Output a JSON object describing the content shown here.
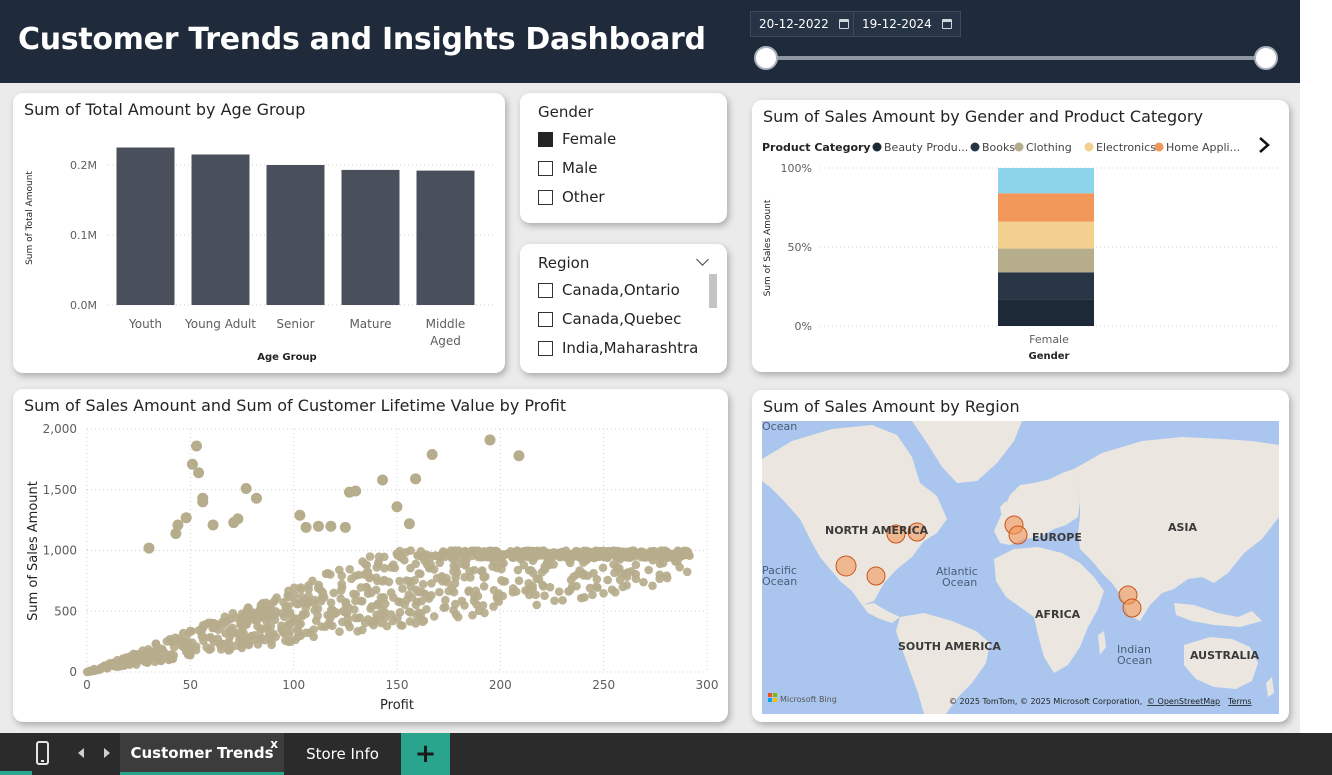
{
  "header": {
    "title": "Customer Trends and Insights Dashboard",
    "date_start": "20-12-2022",
    "date_end": "19-12-2024",
    "date_range_fraction": [
      0,
      1
    ]
  },
  "age_chart": {
    "title": "Sum of Total Amount by Age Group",
    "chart_data": {
      "type": "bar",
      "title": "Sum of Total Amount by Age Group",
      "categories": [
        "Youth",
        "Young Adult",
        "Senior",
        "Mature",
        "Middle Aged"
      ],
      "values": [
        225000,
        215000,
        200000,
        193000,
        192000
      ],
      "xlabel": "Age Group",
      "ylabel": "Sum of Total Amount",
      "ylim": [
        0,
        0.24
      ],
      "yticks": [
        "0.0M",
        "0.1M",
        "0.2M"
      ],
      "bar_color": "#4a505b",
      "grid": true
    }
  },
  "gender_slicer": {
    "title": "Gender",
    "items": [
      {
        "label": "Female",
        "checked": true
      },
      {
        "label": "Male",
        "checked": false
      },
      {
        "label": "Other",
        "checked": false
      }
    ]
  },
  "region_slicer": {
    "title": "Region",
    "items": [
      {
        "label": "Canada,Ontario",
        "checked": false
      },
      {
        "label": "Canada,Quebec",
        "checked": false
      },
      {
        "label": "India,Maharashtra",
        "checked": false
      }
    ]
  },
  "gender_category_chart": {
    "title": "Sum of Sales Amount by Gender and Product Category",
    "legend_title": "Product Category",
    "legend_items": [
      {
        "label": "Beauty Produ...",
        "color": "#1d2936"
      },
      {
        "label": "Books",
        "color": "#273545"
      },
      {
        "label": "Clothing",
        "color": "#b6ad8c"
      },
      {
        "label": "Electronics",
        "color": "#f2d08f"
      },
      {
        "label": "Home Appli...",
        "color": "#f2975a"
      }
    ],
    "chart_data": {
      "type": "bar",
      "stacked": "100%",
      "title": "Sum of Sales Amount by Gender and Product Category",
      "categories": [
        "Female"
      ],
      "xlabel": "Gender",
      "ylabel": "Sum of Sales Amount",
      "yticks": [
        "0%",
        "50%",
        "100%"
      ],
      "series": [
        {
          "name": "Beauty Produ...",
          "values": [
            17
          ],
          "color": "#1d2936"
        },
        {
          "name": "Books",
          "values": [
            17
          ],
          "color": "#273545"
        },
        {
          "name": "Clothing",
          "values": [
            15
          ],
          "color": "#b6ad8c"
        },
        {
          "name": "Electronics",
          "values": [
            17
          ],
          "color": "#f2d08f"
        },
        {
          "name": "Home Appli...",
          "values": [
            18
          ],
          "color": "#f2975a"
        },
        {
          "values": [
            16
          ],
          "color": "#8dd3ea"
        }
      ]
    }
  },
  "scatter_chart": {
    "title": "Sum of Sales Amount and Sum of Customer Lifetime Value by Profit",
    "chart_data": {
      "type": "scatter",
      "title": "Sum of Sales Amount and Sum of Customer Lifetime Value by Profit",
      "xlabel": "Profit",
      "ylabel": "Sum of Sales Amount",
      "xlim": [
        0,
        300
      ],
      "ylim": [
        0,
        2000
      ],
      "xticks": [
        "0",
        "50",
        "100",
        "150",
        "200",
        "250",
        "300"
      ],
      "yticks": [
        "0",
        "500",
        "1,000",
        "1,500",
        "2,000"
      ],
      "point_color": "#b6ad8c",
      "outliers": [
        [
          53,
          1860
        ],
        [
          51,
          1710
        ],
        [
          54,
          1640
        ],
        [
          56,
          1430
        ],
        [
          56,
          1400
        ],
        [
          77,
          1510
        ],
        [
          82,
          1430
        ],
        [
          195,
          1910
        ],
        [
          209,
          1780
        ],
        [
          167,
          1790
        ],
        [
          143,
          1580
        ],
        [
          159,
          1590
        ],
        [
          127,
          1480
        ],
        [
          130,
          1490
        ],
        [
          44,
          1210
        ],
        [
          43,
          1140
        ],
        [
          48,
          1270
        ],
        [
          61,
          1210
        ],
        [
          71,
          1230
        ],
        [
          73,
          1260
        ],
        [
          103,
          1290
        ],
        [
          106,
          1190
        ],
        [
          112,
          1200
        ],
        [
          118,
          1200
        ],
        [
          125,
          1190
        ],
        [
          150,
          1360
        ],
        [
          156,
          1220
        ],
        [
          30,
          1020
        ]
      ],
      "cloud": "approx. 1,000 points with Sales Amount between about 2.5x and 7x Profit, capped near 1,000",
      "cloud_profit_range": [
        0,
        292
      ],
      "cloud_sales_ratio": [
        2.5,
        7
      ],
      "cloud_sales_cap": 1000
    }
  },
  "map_card": {
    "title": "Sum of Sales Amount by Region",
    "labels": {
      "ocean_top": "Ocean",
      "north_america": "NORTH AMERICA",
      "europe": "EUROPE",
      "asia": "ASIA",
      "pacific": "Pacific",
      "pacific2": "Ocean",
      "atlantic": "Atlantic",
      "atlantic2": "Ocean",
      "africa": "AFRICA",
      "south_america": "SOUTH AMERICA",
      "indian": "Indian",
      "indian2": "Ocean",
      "australia": "AUSTRALIA",
      "bing": "Microsoft Bing",
      "copyright": "© 2025 TomTom, © 2025 Microsoft Corporation,",
      "osm": "© OpenStreetMap",
      "terms": "Terms"
    },
    "bubble_color": "#f2975a",
    "bubble_count": 10
  },
  "tabs": {
    "items": [
      {
        "label": "Customer Trends",
        "active": true
      },
      {
        "label": "Store Info",
        "active": false
      }
    ],
    "close_label": "x",
    "add_label": "+"
  }
}
